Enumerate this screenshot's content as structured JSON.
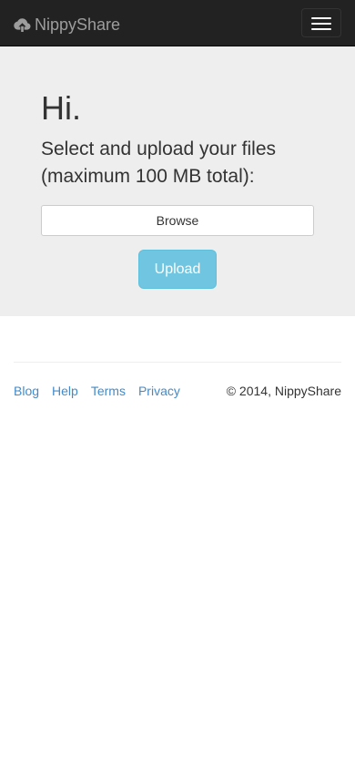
{
  "navbar": {
    "brand_label": "NippyShare",
    "brand_icon": "cloud-upload-icon",
    "toggle_icon": "hamburger-menu-icon"
  },
  "hero": {
    "greeting": "Hi.",
    "lead": "Select and upload your files (maximum 100 MB total):",
    "browse_label": "Browse",
    "upload_label": "Upload"
  },
  "footer": {
    "links": [
      {
        "label": "Blog"
      },
      {
        "label": "Help"
      },
      {
        "label": "Terms"
      },
      {
        "label": "Privacy"
      }
    ],
    "copyright": "© 2014, NippyShare"
  },
  "colors": {
    "navbar_bg": "#222222",
    "navbar_text": "#9d9d9d",
    "jumbotron_bg": "#eeeeee",
    "upload_button": "#5bc0de",
    "link": "#428bca"
  }
}
